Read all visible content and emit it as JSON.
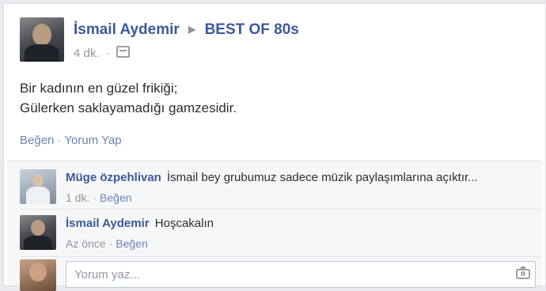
{
  "post": {
    "author": "İsmail Aydemir",
    "group": "BEST OF 80s",
    "time": "4 dk.",
    "text_line1": "Bir kadının en güzel frikiği;",
    "text_line2": "Gülerken saklayamadığı gamzesidir.",
    "like_label": "Beğen",
    "comment_label": "Yorum Yap"
  },
  "comments": [
    {
      "author": "Müge özpehlivan",
      "text": "İsmail bey grubumuz sadece müzik paylaşımlarına açıktır...",
      "time": "1 dk.",
      "like_label": "Beğen"
    },
    {
      "author": "İsmail Aydemir",
      "text": "Hoşcakalın",
      "time": "Az önce",
      "like_label": "Beğen"
    }
  ],
  "composer": {
    "placeholder": "Yorum yaz..."
  },
  "icons": {
    "audience": "group-icon",
    "separator": "triangle-right-icon",
    "attach_photo": "camera-icon"
  },
  "colors": {
    "link_blue": "#3b5998",
    "action_blue": "#6d84b4",
    "meta_gray": "#90949c",
    "background": "#e9ebee"
  }
}
